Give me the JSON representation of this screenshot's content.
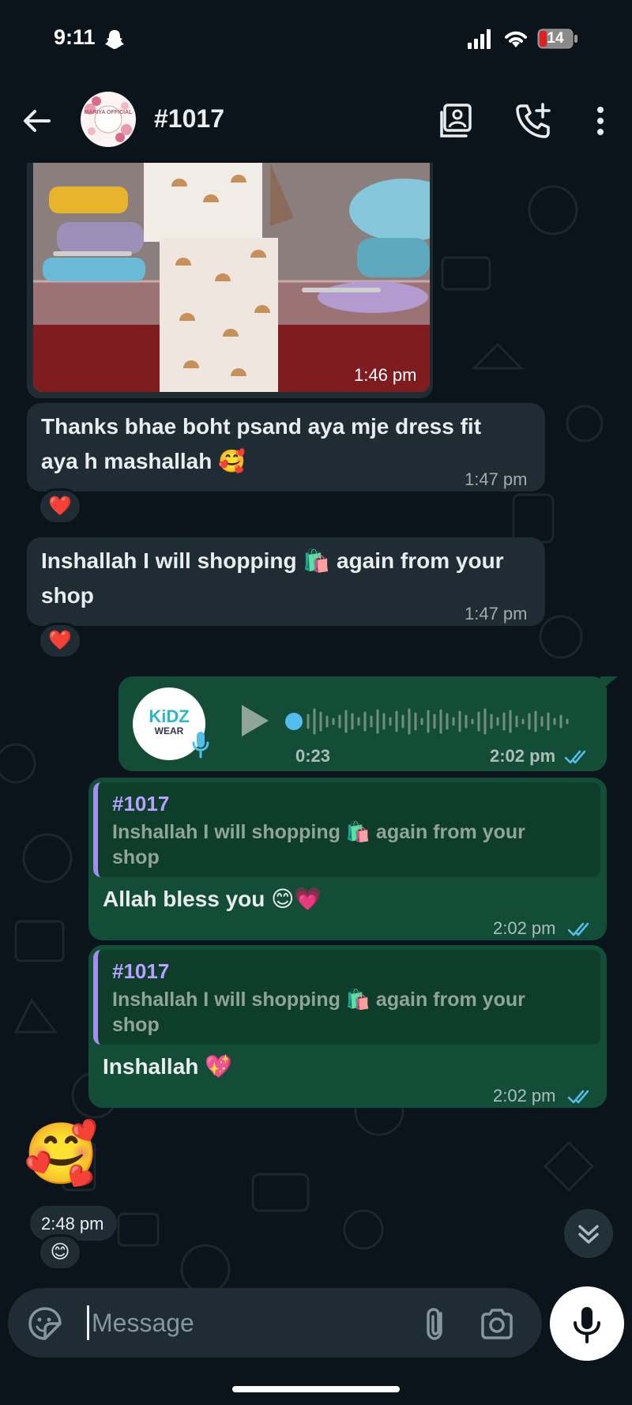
{
  "status_bar": {
    "time": "9:11",
    "battery": "14"
  },
  "header": {
    "title": "#1017",
    "avatar_text": "MARIYA OFFICIAL"
  },
  "messages": {
    "image": {
      "time": "1:46 pm"
    },
    "m1": {
      "text_line1": "Thanks bhae boht psand aya mje dress fit",
      "text_line2": "aya h mashallah 🥰",
      "time": "1:47 pm",
      "reaction": "❤️"
    },
    "m2": {
      "text_line1": "Inshallah I will shopping 🛍️ again from your",
      "text_line2": "shop",
      "time": "1:47 pm",
      "reaction": "❤️"
    },
    "voice": {
      "duration": "0:23",
      "time": "2:02 pm",
      "avatar_text_top": "KiDZ",
      "avatar_text_bottom": "WEAR"
    },
    "m3": {
      "quote_title": "#1017",
      "quote_line1": "Inshallah I will shopping 🛍️ again from your",
      "quote_line2": "shop",
      "text": "Allah bless you 😊💗",
      "time": "2:02 pm"
    },
    "m4": {
      "quote_title": "#1017",
      "quote_line1": "Inshallah I will shopping 🛍️ again from your",
      "quote_line2": "shop",
      "text": "Inshallah 💖",
      "time": "2:02 pm"
    },
    "m5": {
      "emoji": "🥰",
      "time": "2:48 pm",
      "reaction": "😊"
    }
  },
  "composer": {
    "placeholder": "Message"
  },
  "colors": {
    "incoming": "#202c33",
    "outgoing": "#144d37",
    "background": "#0b141a",
    "tick_read": "#53bdeb"
  }
}
